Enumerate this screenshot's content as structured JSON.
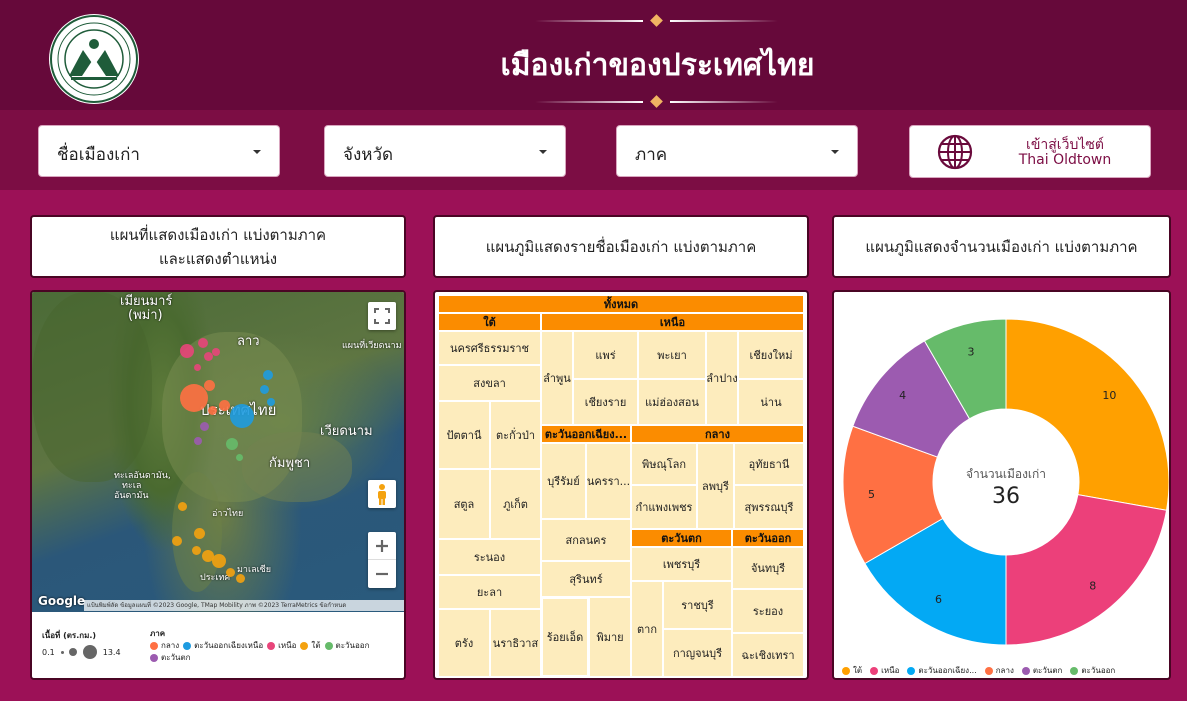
{
  "header": {
    "title": "เมืองเก่าของประเทศไทย",
    "colors": {
      "background": "#66093a",
      "ornament": "#f0b462"
    }
  },
  "filters": [
    {
      "label": "ชื่อเมืองเก่า"
    },
    {
      "label": "จังหวัด"
    },
    {
      "label": "ภาค"
    }
  ],
  "site_button": {
    "line1": "เข้าสู่เว็บไซต์",
    "line2": "Thai Oldtown"
  },
  "map_panel": {
    "title_line1": "แผนที่แสดงเมืองเก่า แบ่งตามภาค",
    "title_line2": "และแสดงตำแหน่ง",
    "labels": [
      "เมียนมาร์ (พม่า)",
      "ลาว",
      "ประเทศไทย",
      "กัมพูชา",
      "เวียดนาม",
      "ทะเลอันดามัน",
      "อ่าวไทย",
      "แผนที่เวียดนาม"
    ],
    "map_labels": {
      "myanmar": "เมียนมาร์",
      "myanmar2": "(พม่า)",
      "laos": "ลาว",
      "thailand": "ประเทศไทย",
      "cambodia": "กัมพูชา",
      "vietnam": "เวียดนาม",
      "andaman1": "ทะเลอันดามัน,",
      "andaman2": "ทะเล",
      "andaman3": "อันดามัน",
      "gulf": "อ่าวไทย",
      "hainan": "แผนที่เวียดนาม",
      "malay1": "มาเลเซีย",
      "malay2": "ประเทศ"
    },
    "google": "Google",
    "attribution": "แป้นพิมพ์ลัด   ข้อมูลแผนที่ ©2023 Google, TMap Mobility ภาพ ©2023 TerraMetrics   ข้อกำหนด",
    "legend": {
      "size_title": "เนื้อที่ (ตร.กม.)",
      "size_min": "0.1",
      "size_max": "13.4",
      "region_title": "ภาค",
      "regions": [
        {
          "name": "กลาง",
          "color": "#ff7043"
        },
        {
          "name": "ตะวันออกเฉียงเหนือ",
          "color": "#1e9be0"
        },
        {
          "name": "เหนือ",
          "color": "#e8457a"
        },
        {
          "name": "ใต้",
          "color": "#f4a20f"
        },
        {
          "name": "ตะวันออก",
          "color": "#66bb6a"
        },
        {
          "name": "ตะวันตก",
          "color": "#9c5bb0"
        }
      ]
    }
  },
  "treemap_panel": {
    "title": "แผนภูมิแสดงรายชื่อเมืองเก่า แบ่งตามภาค",
    "root": "ทั้งหมด",
    "headers": {
      "south": "ใต้",
      "north": "เหนือ",
      "northeast": "ตะวันออกเฉียง...",
      "central": "กลาง",
      "west": "ตะวันตก",
      "east": "ตะวันออก"
    },
    "cells": {
      "south": [
        "นครศรีธรรมราช",
        "สงขลา",
        "ปัตตานี",
        "ตะกั่วป่า",
        "สตูล",
        "ภูเก็ต",
        "ระนอง",
        "ยะลา",
        "ตรัง",
        "นราธิวาส"
      ],
      "north": [
        "ลำพูน",
        "แพร่",
        "พะเยา",
        "ลำปาง",
        "เชียงใหม่",
        "เชียงราย",
        "แม่ฮ่องสอน",
        "น่าน"
      ],
      "northeast": [
        "บุรีรัมย์",
        "นครรา...",
        "สกลนคร",
        "สุรินทร์",
        "ร้อยเอ็ด",
        "พิมาย"
      ],
      "central": [
        "พิษณุโลก",
        "ลพบุรี",
        "อุทัยธานี",
        "กำแพงเพชร",
        "สุพรรณบุรี"
      ],
      "west": [
        "เพชรบุรี",
        "ตาก",
        "ราชบุรี",
        "กาญจนบุรี"
      ],
      "east": [
        "จันทบุรี",
        "ระยอง",
        "ฉะเชิงเทรา"
      ]
    }
  },
  "donut_panel": {
    "title": "แผนภูมิแสดงจำนวนเมืองเก่า แบ่งตามภาค",
    "center_label": "จำนวนเมืองเก่า",
    "center_value": "36"
  },
  "chart_data": {
    "type": "pie",
    "title": "แผนภูมิแสดงจำนวนเมืองเก่า แบ่งตามภาค",
    "legend_position": "bottom",
    "categories": [
      "ใต้",
      "เหนือ",
      "ตะวันออกเฉียง...",
      "กลาง",
      "ตะวันตก",
      "ตะวันออก"
    ],
    "values": [
      10,
      8,
      6,
      5,
      4,
      3
    ],
    "colors": [
      "#ffa000",
      "#ec407a",
      "#03a9f4",
      "#ff7043",
      "#9c5bb0",
      "#66bb6a"
    ],
    "total": 36
  }
}
